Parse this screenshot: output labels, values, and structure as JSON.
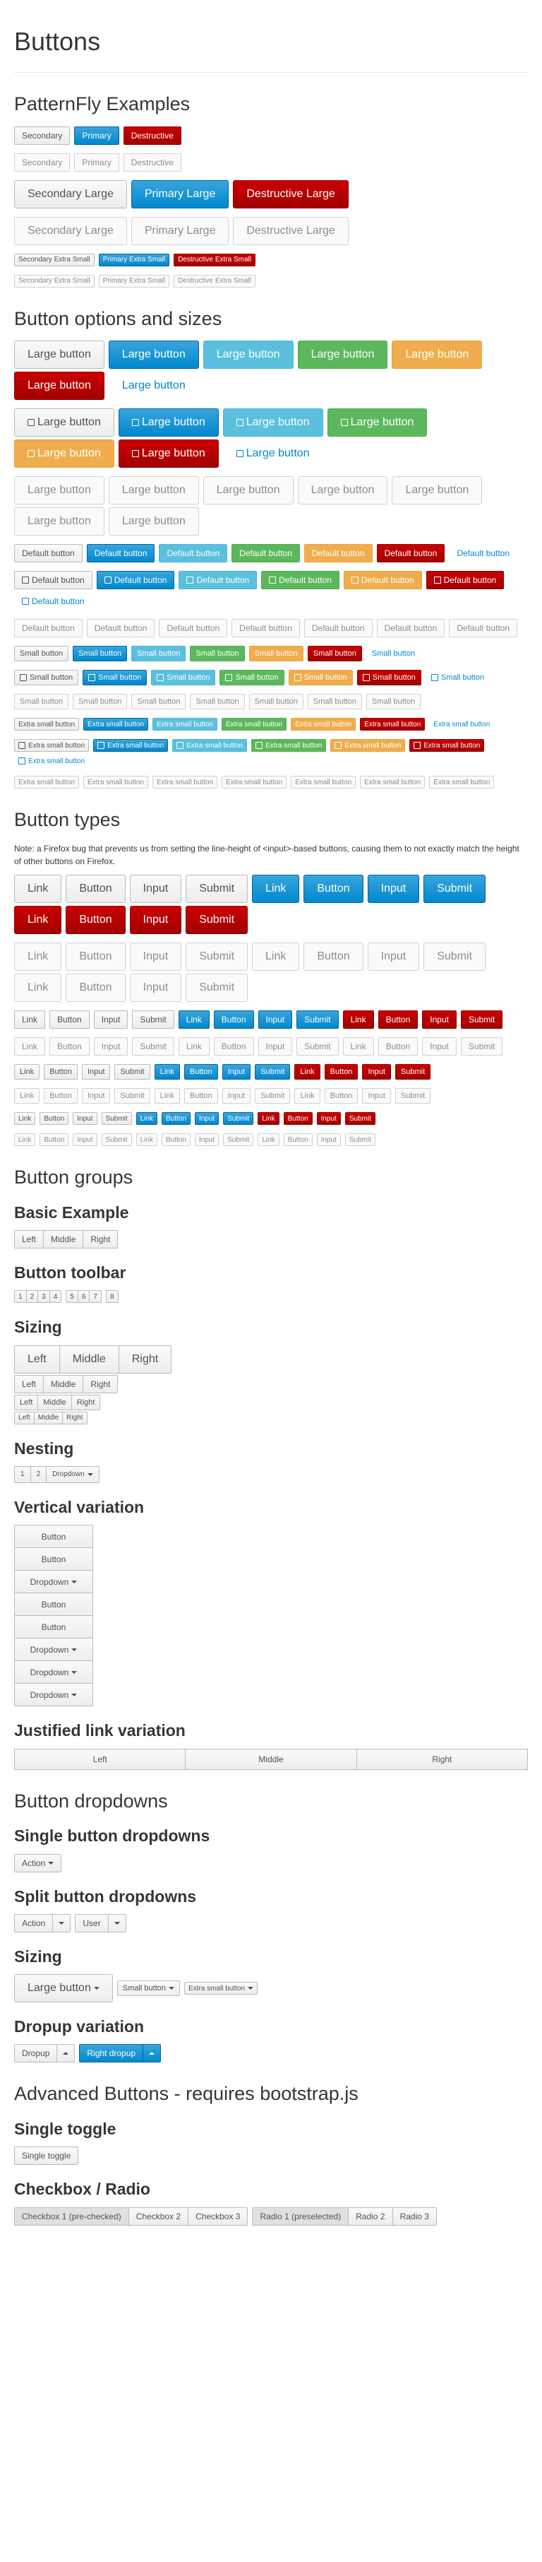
{
  "page_title": "Buttons",
  "pf": {
    "title": "PatternFly Examples",
    "secondary": "Secondary",
    "primary": "Primary",
    "destructive": "Destructive",
    "secondary_large": "Secondary Large",
    "primary_large": "Primary Large",
    "destructive_large": "Destructive Large",
    "secondary_xs": "Secondary Extra Small",
    "primary_xs": "Primary Extra Small",
    "destructive_xs": "Destructive Extra Small"
  },
  "opts": {
    "title": "Button options and sizes",
    "large": "Large button",
    "default": "Default button",
    "small": "Small button",
    "xsmall": "Extra small button"
  },
  "types": {
    "title": "Button types",
    "note": "Note: a Firefox bug that prevents us from setting the line-height of <input>-based buttons, causing them to not exactly match the height of other buttons on Firefox.",
    "link": "Link",
    "button": "Button",
    "input": "Input",
    "submit": "Submit"
  },
  "groups": {
    "title": "Button groups",
    "basic": "Basic Example",
    "left": "Left",
    "middle": "Middle",
    "right": "Right",
    "toolbar": "Button toolbar",
    "toolbar_items": [
      "1",
      "2",
      "3",
      "4",
      "5",
      "6",
      "7",
      "8"
    ],
    "sizing": "Sizing",
    "nesting": "Nesting",
    "dropdown": "Dropdown",
    "vertical": "Vertical variation",
    "vbutton": "Button",
    "justified": "Justified link variation"
  },
  "dropdowns": {
    "title": "Button dropdowns",
    "single": "Single button dropdowns",
    "action": "Action",
    "split": "Split button dropdowns",
    "user": "User",
    "sizing": "Sizing",
    "large": "Large button",
    "small": "Small button",
    "xsmall": "Extra small button",
    "dropup": "Dropup variation",
    "dropup_label": "Dropup",
    "right_dropup": "Right dropup"
  },
  "advanced": {
    "title": "Advanced Buttons - requires bootstrap.js",
    "single_toggle": "Single toggle",
    "single_toggle_btn": "Single toggle",
    "checkbox_radio": "Checkbox / Radio",
    "cb1": "Checkbox 1 (pre-checked)",
    "cb2": "Checkbox 2",
    "cb3": "Checkbox 3",
    "r1": "Radio 1 (preselected)",
    "r2": "Radio 2",
    "r3": "Radio 3"
  }
}
